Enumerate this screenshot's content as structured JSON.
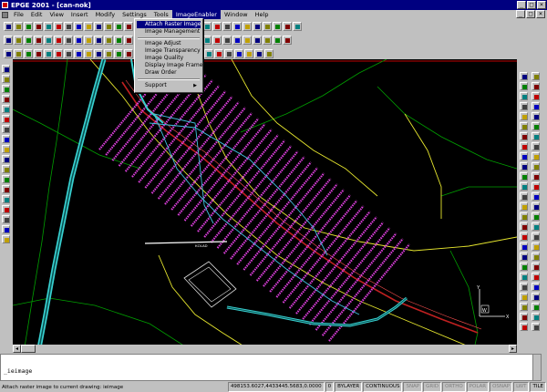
{
  "title": "EPGE 2001 - [can-nok]",
  "menu": [
    "File",
    "Edit",
    "View",
    "Insert",
    "Modify",
    "Settings",
    "Tools",
    "ImageEnabler",
    "Window",
    "Help"
  ],
  "active_menu": "ImageEnabler",
  "dropdown": {
    "items": [
      {
        "label": "Attach Raster Image",
        "highlighted": true
      },
      {
        "label": "Image Management"
      },
      {
        "separator": true
      },
      {
        "label": "Image Adjust"
      },
      {
        "label": "Image Transparency"
      },
      {
        "label": "Image Quality"
      },
      {
        "label": "Display Image Frame"
      },
      {
        "label": "Draw Order"
      },
      {
        "separator": true
      },
      {
        "label": "Support",
        "submenu": true
      }
    ]
  },
  "layer_name": "",
  "command": {
    "history": [
      ""
    ],
    "current": "_ieimage"
  },
  "status": {
    "message": "Attach raster image to current drawing: ieimage",
    "coords": "498153.6027,4433445.5683,0.0000",
    "layer": "0",
    "color": "BYLAYER",
    "linetype": "CONTINUOUS",
    "snap": "SNAP",
    "grid": "GRID",
    "ortho": "ORTHO",
    "polar": "POLAR",
    "osnap": "OSNAP",
    "lwt": "LWT",
    "tile": "TILE"
  },
  "ucs_labels": {
    "y": "Y",
    "w": "W",
    "x": "X"
  },
  "map_label": "KOLAD"
}
